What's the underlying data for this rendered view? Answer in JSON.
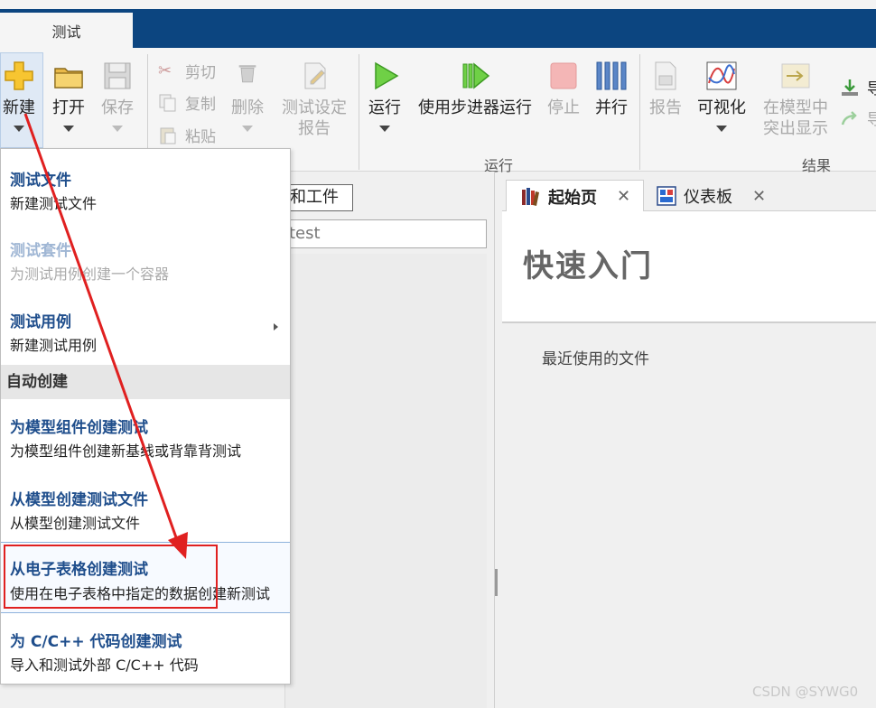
{
  "app": {
    "tab_label": "测试"
  },
  "ribbon": {
    "new_label": "新建",
    "open_label": "打开",
    "save_label": "保存",
    "cut_label": "剪切",
    "copy_label": "复制",
    "paste_label": "粘贴",
    "delete_label": "删除",
    "test_settings_label_line1": "测试设定",
    "test_settings_label_line2": "报告",
    "run_label": "运行",
    "stepper_run_label": "使用步进器运行",
    "stop_label": "停止",
    "parallel_label": "并行",
    "report_label": "报告",
    "visualize_label": "可视化",
    "highlight_label_line1": "在模型中",
    "highlight_label_line2": "突出显示",
    "export_label_partial": "导",
    "export2_label_partial": "导",
    "section_run": "运行",
    "section_results": "结果"
  },
  "left_panel": {
    "button_partial": "和工件",
    "filter_partial": "test"
  },
  "right_panel": {
    "tabs": [
      {
        "label": "起始页",
        "close": "✕"
      },
      {
        "label": "仪表板",
        "close": "✕"
      }
    ],
    "quickstart_title": "快速入门",
    "recent_files": "最近使用的文件"
  },
  "menu": {
    "items": [
      {
        "title": "测试文件",
        "desc": "新建测试文件"
      },
      {
        "title": "测试套件",
        "desc": "为测试用例创建一个容器"
      },
      {
        "title": "测试用例",
        "desc": "新建测试用例"
      }
    ],
    "section_auto": "自动创建",
    "auto_items": [
      {
        "title": "为模型组件创建测试",
        "desc": "为模型组件创建新基线或背靠背测试"
      },
      {
        "title": "从模型创建测试文件",
        "desc": "从模型创建测试文件"
      },
      {
        "title": "从电子表格创建测试",
        "desc": "使用在电子表格中指定的数据创建新测试"
      },
      {
        "title": "为 C/C++ 代码创建测试",
        "desc": "导入和测试外部 C/C++ 代码"
      }
    ]
  },
  "watermark": "CSDN @SYWG0",
  "colors": {
    "title_bar": "#0c4580",
    "menu_title": "#1f4e8c",
    "annotation_red": "#e02020"
  }
}
